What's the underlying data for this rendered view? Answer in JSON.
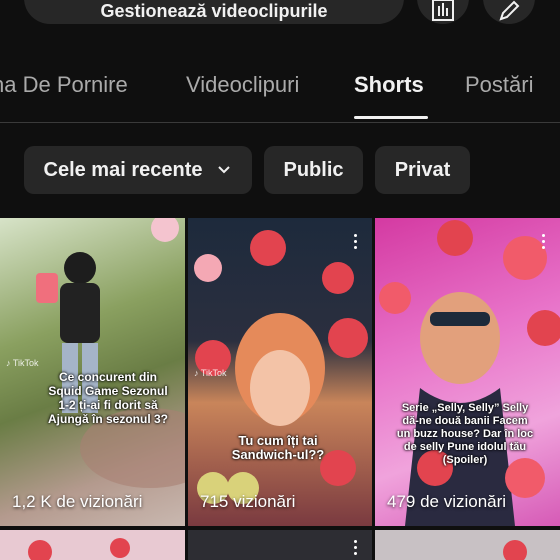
{
  "header": {
    "manage_label": "Gestionează videoclipurile"
  },
  "tabs": [
    {
      "label": "na De Pornire",
      "active": false
    },
    {
      "label": "Videoclipuri",
      "active": false
    },
    {
      "label": "Shorts",
      "active": true
    },
    {
      "label": "Postări",
      "active": false
    }
  ],
  "filters": {
    "sort": "Cele mai recente",
    "public": "Public",
    "private": "Privat"
  },
  "shorts": [
    {
      "caption": "Ce concurent din Squid Game Sezonul 1-2 ți-ai fi dorit să Ajungă în sezonul 3?",
      "views": "1,2 K de vizionări"
    },
    {
      "caption": "Tu cum îți tai Sandwich-ul??",
      "views": "715 vizionări"
    },
    {
      "caption": "Serie „Selly, Selly” Selly dă-ne două banii Facem un buzz house? Dar în loc de selly Pune idolul tău (Spoiler)",
      "views": "479 de vizionări"
    }
  ],
  "colors": {
    "background": "#0f0f0f",
    "chip": "#272727",
    "muted_text": "#aaaaaa"
  }
}
